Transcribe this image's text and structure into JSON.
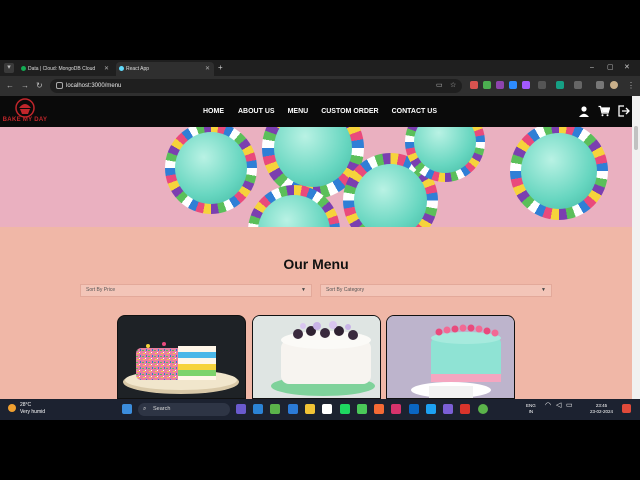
{
  "browser": {
    "tabs": [
      {
        "title": "Data | Cloud: MongoDB Cloud",
        "favicon_color": "#13aa52",
        "active": false
      },
      {
        "title": "React App",
        "favicon_color": "#61dafb",
        "active": true
      }
    ],
    "new_tab": "+",
    "url": "localhost:3000/menu",
    "window_controls": {
      "minimize": "–",
      "maximize": "▢",
      "close": "✕"
    }
  },
  "site": {
    "logo_text": "BAKE MY DAY",
    "nav": [
      {
        "label": "HOME"
      },
      {
        "label": "ABOUT US"
      },
      {
        "label": "MENU"
      },
      {
        "label": "CUSTOM ORDER"
      },
      {
        "label": "CONTACT US"
      }
    ],
    "actions": [
      "user-icon",
      "cart-icon",
      "logout-icon"
    ],
    "brand_color": "#c0262b",
    "page_bg": "#f0b7a7"
  },
  "menu": {
    "title": "Our Menu",
    "sort_price_placeholder": "Sort By Price",
    "sort_category_placeholder": "Sort By Category",
    "cards": [
      {
        "name": "rainbow-sprinkle-cake"
      },
      {
        "name": "blackberry-cream-cake"
      },
      {
        "name": "mint-raspberry-cake"
      }
    ]
  },
  "taskbar": {
    "weather_temp": "28°C",
    "weather_desc": "Very humid",
    "search_label": "Search",
    "lang_line1": "ENG",
    "lang_line2": "IN",
    "time": "23:45",
    "date": "23-02-2024"
  }
}
